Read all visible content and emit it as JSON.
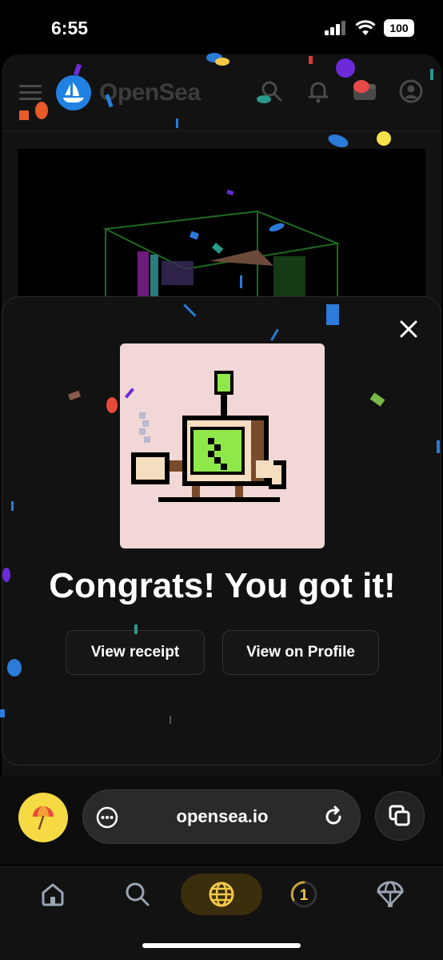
{
  "status_bar": {
    "time": "6:55",
    "battery": "100"
  },
  "header": {
    "brand": "OpenSea"
  },
  "modal": {
    "headline": "Congrats! You got it!",
    "view_receipt_label": "View receipt",
    "view_profile_label": "View on Profile"
  },
  "browser": {
    "url": "opensea.io"
  },
  "tab_bar": {
    "points_count": "1"
  },
  "colors": {
    "accent_yellow": "#f5da44",
    "opensea_blue": "#2081e2",
    "nft_background": "#f2d7d7",
    "robot_screen": "#8ee84a"
  }
}
